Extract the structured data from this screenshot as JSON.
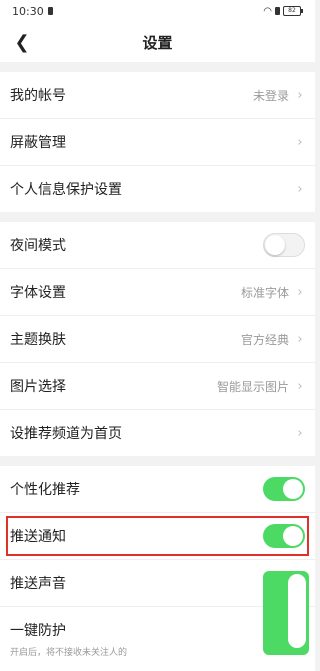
{
  "status": {
    "time": "10:30",
    "battery": "82"
  },
  "nav": {
    "title": "设置"
  },
  "section1": [
    {
      "label": "我的帐号",
      "value": "未登录"
    },
    {
      "label": "屏蔽管理",
      "value": ""
    },
    {
      "label": "个人信息保护设置",
      "value": ""
    }
  ],
  "section2": [
    {
      "label": "夜间模式"
    },
    {
      "label": "字体设置",
      "value": "标准字体"
    },
    {
      "label": "主题换肤",
      "value": "官方经典"
    },
    {
      "label": "图片选择",
      "value": "智能显示图片"
    },
    {
      "label": "设推荐频道为首页"
    }
  ],
  "section3": [
    {
      "label": "个性化推荐",
      "state": "on"
    },
    {
      "label": "推送通知",
      "state": "on"
    },
    {
      "label": "推送声音",
      "state": "on"
    },
    {
      "label": "一键防护",
      "sub": "开启后，将不接收未关注人的"
    }
  ],
  "colors": {
    "toggle_on": "#4cd964",
    "highlight": "#e0302a"
  }
}
